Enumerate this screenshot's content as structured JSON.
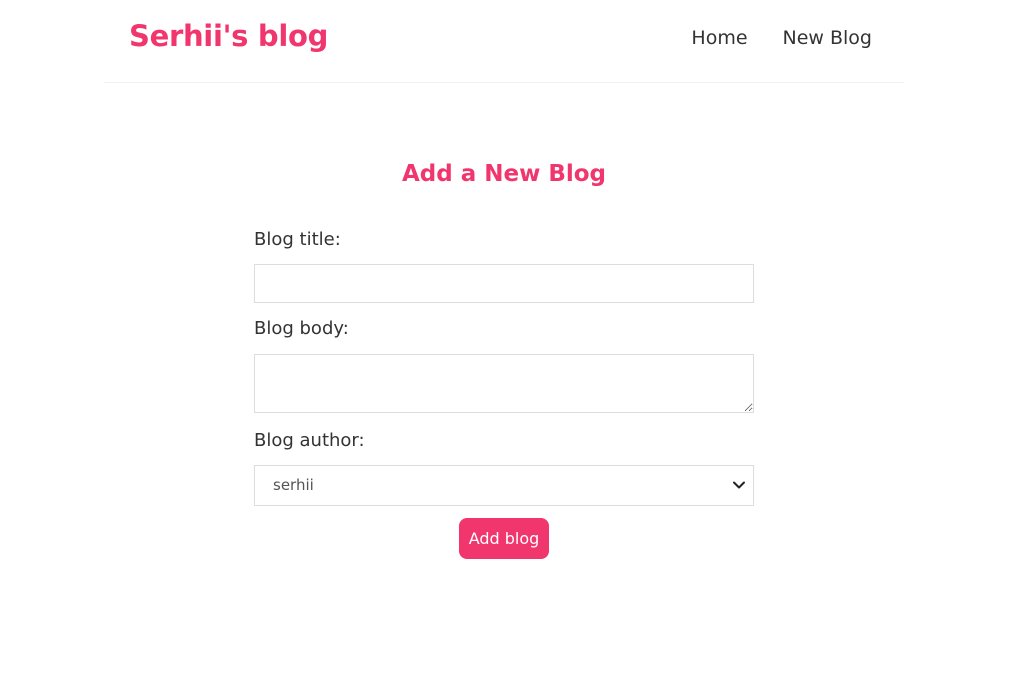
{
  "brand": {
    "title": "Serhii's blog",
    "color": "#f1356d"
  },
  "nav": {
    "links": [
      {
        "label": "Home"
      },
      {
        "label": "New Blog"
      }
    ]
  },
  "form": {
    "heading": "Add a New Blog",
    "title_label": "Blog title:",
    "title_value": "",
    "body_label": "Blog body:",
    "body_value": "",
    "author_label": "Blog author:",
    "author_selected": "serhii",
    "submit_label": "Add blog"
  },
  "icons": {
    "select_caret": "chevron-down-icon",
    "textarea_resize": "resize-grip-icon"
  }
}
